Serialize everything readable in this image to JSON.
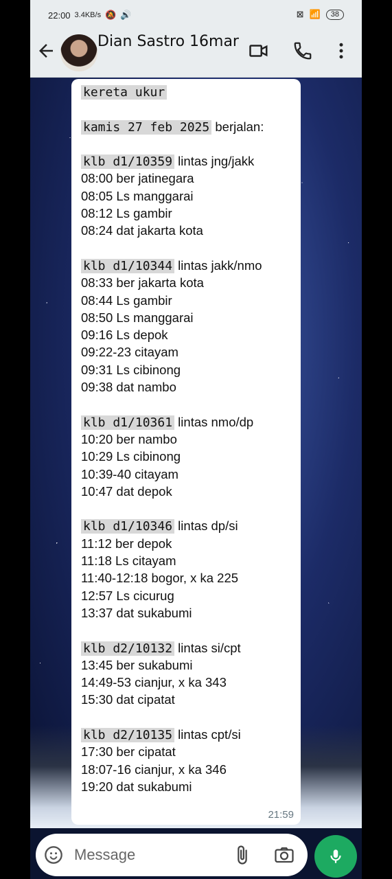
{
  "status_bar": {
    "time": "22:00",
    "speed": "3.4KB/s",
    "battery": "38"
  },
  "header": {
    "contact_name": "Dian Sastro 16mar"
  },
  "message": {
    "lines": [
      [
        {
          "t": "kereta ukur",
          "m": true
        }
      ],
      [],
      [
        {
          "t": "kamis 27 feb 2025",
          "m": true
        },
        {
          "t": " berjalan:",
          "m": false
        }
      ],
      [],
      [
        {
          "t": "klb d1/10359",
          "m": true
        },
        {
          "t": " lintas jng/jakk",
          "m": false
        }
      ],
      [
        {
          "t": "08:00 ber jatinegara",
          "m": false
        }
      ],
      [
        {
          "t": "08:05 Ls manggarai",
          "m": false
        }
      ],
      [
        {
          "t": "08:12 Ls gambir",
          "m": false
        }
      ],
      [
        {
          "t": "08:24 dat jakarta kota",
          "m": false
        }
      ],
      [],
      [
        {
          "t": "klb d1/10344",
          "m": true
        },
        {
          "t": " lintas jakk/nmo",
          "m": false
        }
      ],
      [
        {
          "t": "08:33 ber jakarta kota",
          "m": false
        }
      ],
      [
        {
          "t": "08:44 Ls gambir",
          "m": false
        }
      ],
      [
        {
          "t": "08:50 Ls manggarai",
          "m": false
        }
      ],
      [
        {
          "t": "09:16 Ls depok",
          "m": false
        }
      ],
      [
        {
          "t": "09:22-23 citayam",
          "m": false
        }
      ],
      [
        {
          "t": "09:31 Ls cibinong",
          "m": false
        }
      ],
      [
        {
          "t": "09:38 dat nambo",
          "m": false
        }
      ],
      [],
      [
        {
          "t": "klb d1/10361",
          "m": true
        },
        {
          "t": " lintas nmo/dp",
          "m": false
        }
      ],
      [
        {
          "t": "10:20 ber nambo",
          "m": false
        }
      ],
      [
        {
          "t": "10:29 Ls cibinong",
          "m": false
        }
      ],
      [
        {
          "t": "10:39-40 citayam",
          "m": false
        }
      ],
      [
        {
          "t": "10:47 dat depok",
          "m": false
        }
      ],
      [],
      [
        {
          "t": "klb d1/10346",
          "m": true
        },
        {
          "t": " lintas dp/si",
          "m": false
        }
      ],
      [
        {
          "t": "11:12 ber depok",
          "m": false
        }
      ],
      [
        {
          "t": "11:18 Ls citayam",
          "m": false
        }
      ],
      [
        {
          "t": "11:40-12:18 bogor, x ka 225",
          "m": false
        }
      ],
      [
        {
          "t": "12:57 Ls cicurug",
          "m": false
        }
      ],
      [
        {
          "t": "13:37 dat sukabumi",
          "m": false
        }
      ],
      [],
      [
        {
          "t": "klb d2/10132",
          "m": true
        },
        {
          "t": " lintas si/cpt",
          "m": false
        }
      ],
      [
        {
          "t": "13:45 ber sukabumi",
          "m": false
        }
      ],
      [
        {
          "t": "14:49-53 cianjur, x ka 343",
          "m": false
        }
      ],
      [
        {
          "t": "15:30 dat cipatat",
          "m": false
        }
      ],
      [],
      [
        {
          "t": "klb d2/10135",
          "m": true
        },
        {
          "t": " lintas cpt/si",
          "m": false
        }
      ],
      [
        {
          "t": "17:30 ber cipatat",
          "m": false
        }
      ],
      [
        {
          "t": "18:07-16 cianjur, x ka 346",
          "m": false
        }
      ],
      [
        {
          "t": "19:20 dat sukabumi",
          "m": false
        }
      ]
    ],
    "timestamp": "21:59"
  },
  "composer": {
    "placeholder": "Message"
  },
  "colors": {
    "header_bg": "#e9edef",
    "mic_button": "#1daa61",
    "code_highlight": "#d8d8d8"
  }
}
